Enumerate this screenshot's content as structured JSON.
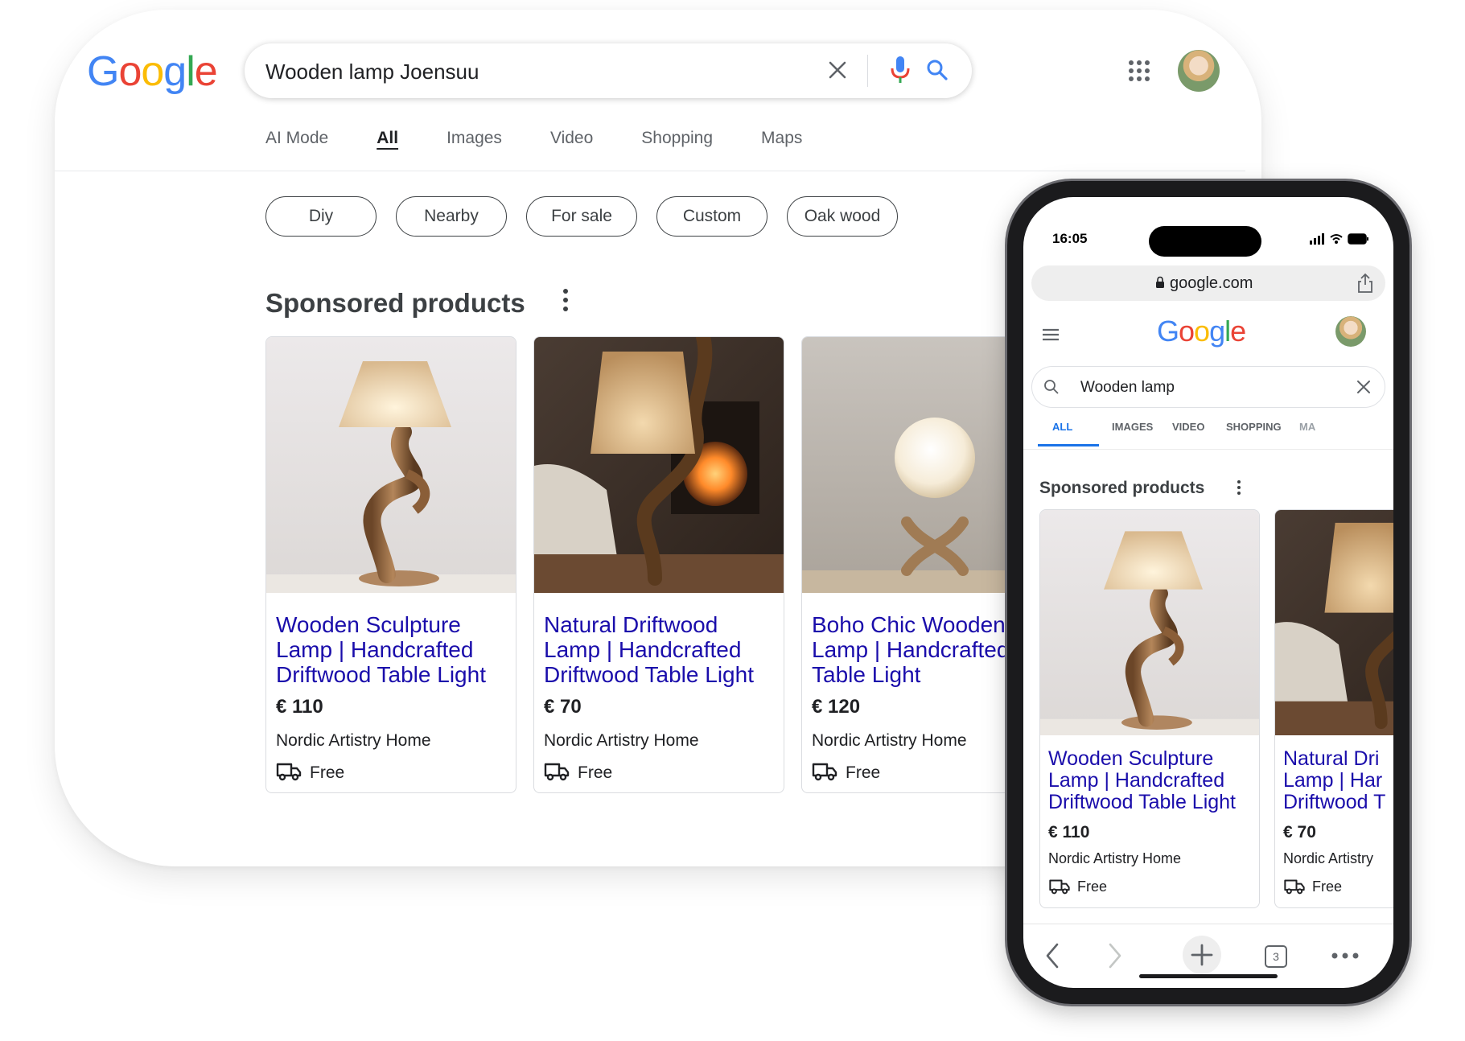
{
  "brand": {
    "logo_letters": [
      {
        "ch": "G",
        "color": "#4285F4"
      },
      {
        "ch": "o",
        "color": "#EA4335"
      },
      {
        "ch": "o",
        "color": "#FBBC05"
      },
      {
        "ch": "g",
        "color": "#4285F4"
      },
      {
        "ch": "l",
        "color": "#34A853"
      },
      {
        "ch": "e",
        "color": "#EA4335"
      }
    ],
    "link_color": "#1a0dab",
    "accent": "#1a73e8"
  },
  "desktop": {
    "search": {
      "value": "Wooden lamp Joensuu"
    },
    "icons": [
      "clear-icon",
      "mic-icon",
      "search-icon",
      "apps-icon",
      "avatar"
    ],
    "tabs": [
      {
        "label": "AI Mode",
        "active": false
      },
      {
        "label": "All",
        "active": true
      },
      {
        "label": "Images",
        "active": false
      },
      {
        "label": "Video",
        "active": false
      },
      {
        "label": "Shopping",
        "active": false
      },
      {
        "label": "Maps",
        "active": false
      }
    ],
    "chips": [
      "Diy",
      "Nearby",
      "For sale",
      "Custom",
      "Oak wood"
    ],
    "sponsored_title": "Sponsored products",
    "products": [
      {
        "title": "Wooden Sculpture Lamp | Handcrafted Driftwood Table Light",
        "price": "€ 110",
        "store": "Nordic Artistry Home",
        "shipping": "Free"
      },
      {
        "title": "Natural Driftwood Lamp | Handcrafted Driftwood Table Light",
        "price": "€ 70",
        "store": "Nordic Artistry Home",
        "shipping": "Free"
      },
      {
        "title": "Boho Chic Wooden Lamp | Handcrafted Table Light",
        "price": "€ 120",
        "store": "Nordic Artistry Home",
        "shipping": "Free"
      }
    ]
  },
  "phone": {
    "status": {
      "time": "16:05"
    },
    "url": "google.com",
    "search": {
      "value": "Wooden lamp"
    },
    "tabs": [
      {
        "label": "ALL",
        "active": true
      },
      {
        "label": "IMAGES",
        "active": false
      },
      {
        "label": "VIDEO",
        "active": false
      },
      {
        "label": "SHOPPING",
        "active": false
      },
      {
        "label": "MA",
        "active": false
      }
    ],
    "sponsored_title": "Sponsored products",
    "products": [
      {
        "title_lines": [
          "Wooden Sculpture",
          "Lamp | Handcrafted",
          "Driftwood Table Light"
        ],
        "price": "€ 110",
        "store": "Nordic Artistry Home",
        "shipping": "Free"
      },
      {
        "title_lines": [
          "Natural Dri",
          "Lamp | Har",
          "Driftwood T"
        ],
        "price": "€ 70",
        "store": "Nordic Artistry",
        "shipping": "Free"
      }
    ],
    "tab_count": "3"
  }
}
